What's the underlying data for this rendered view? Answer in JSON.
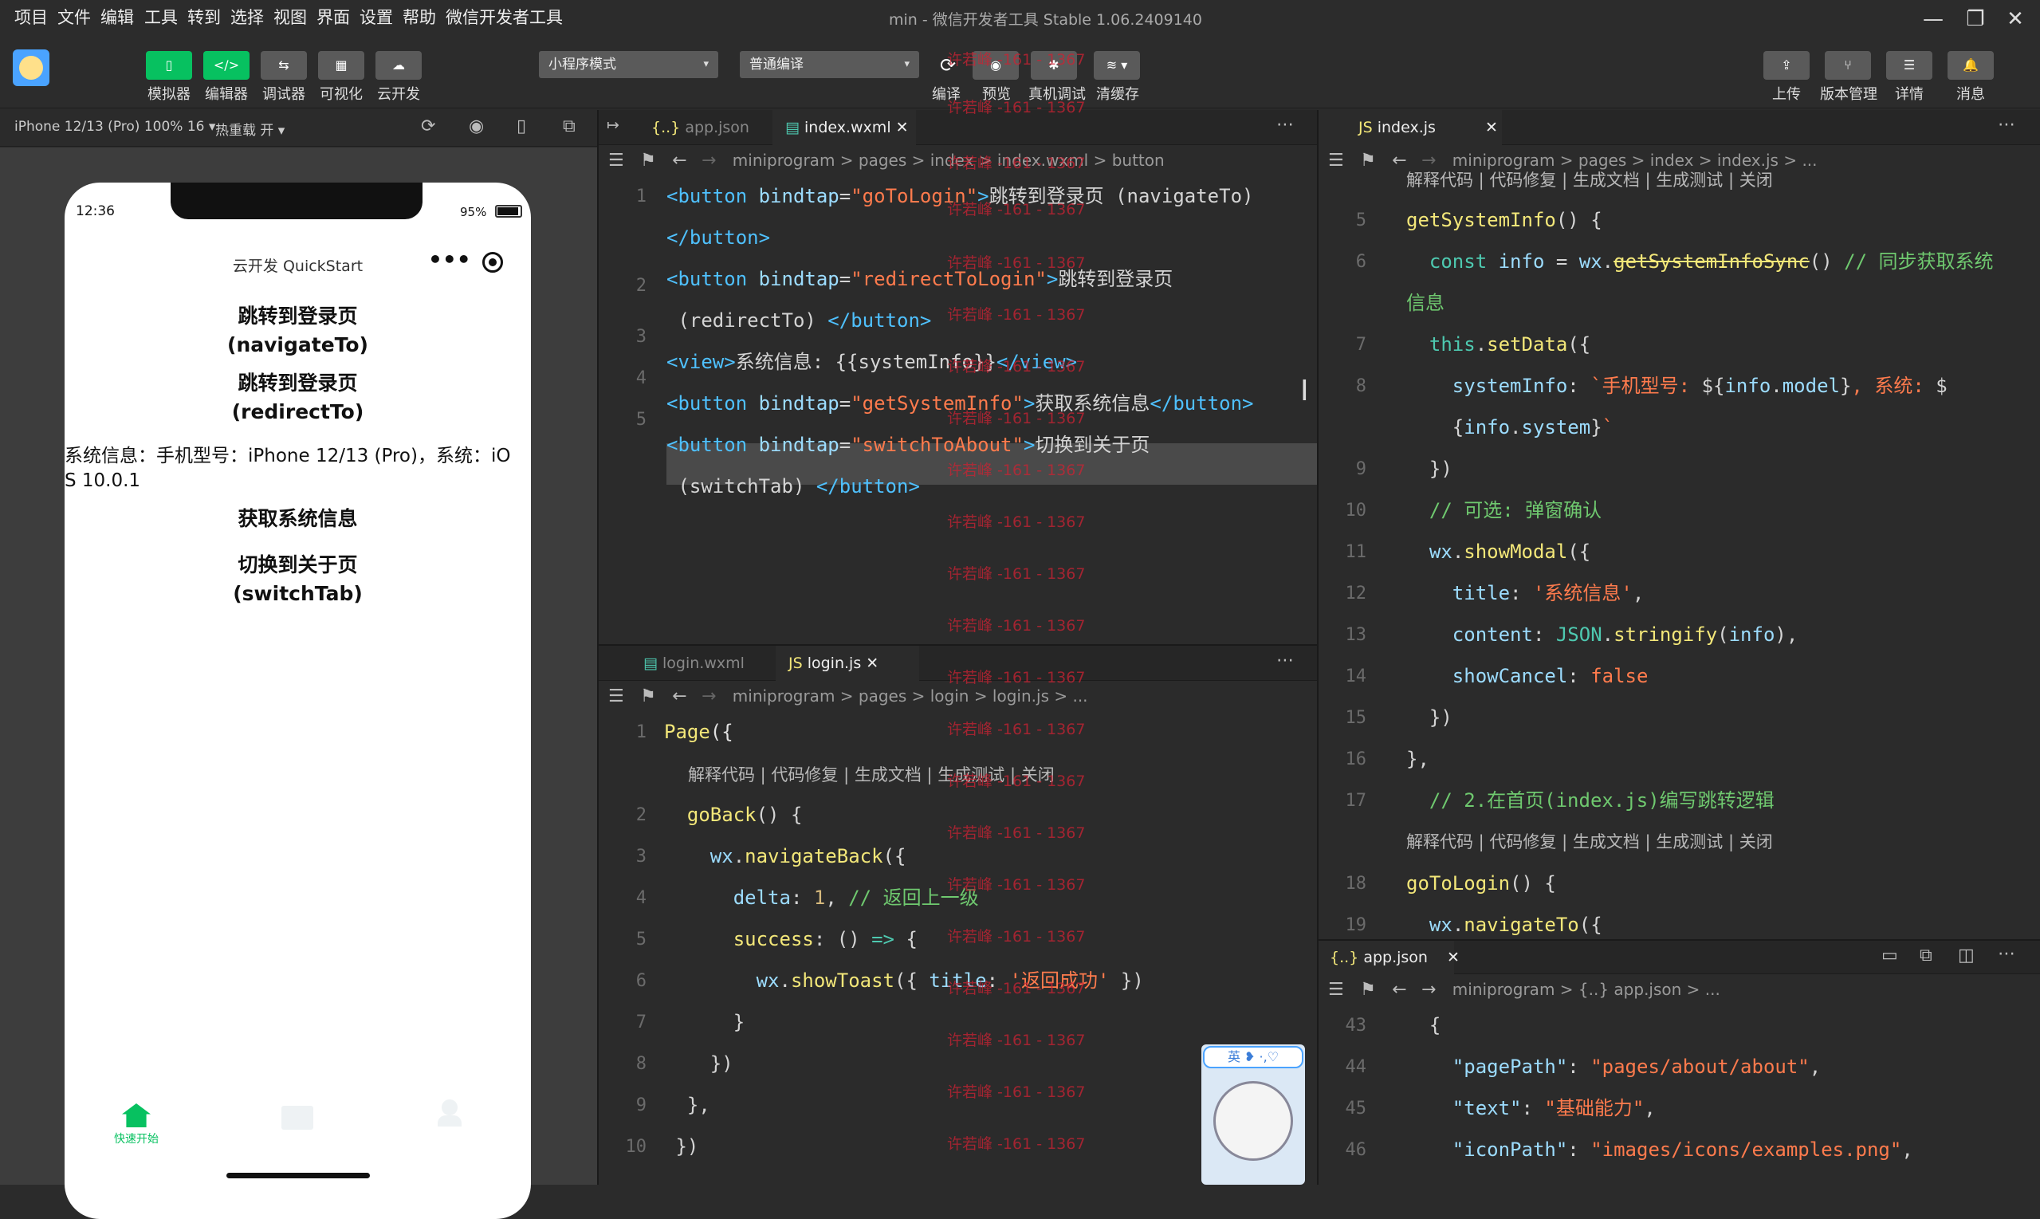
{
  "menu": [
    "项目",
    "文件",
    "编辑",
    "工具",
    "转到",
    "选择",
    "视图",
    "界面",
    "设置",
    "帮助",
    "微信开发者工具"
  ],
  "window_title": "min - 微信开发者工具 Stable 1.06.2409140",
  "toolbar": {
    "left": [
      "模拟器",
      "编辑器",
      "调试器",
      "可视化",
      "云开发"
    ],
    "mode_select": "小程序模式",
    "compile_select": "普通编译",
    "center": [
      "编译",
      "预览",
      "真机调试",
      "清缓存"
    ],
    "right": [
      "上传",
      "版本管理",
      "详情",
      "消息"
    ]
  },
  "simulator": {
    "device_label": "iPhone 12/13 (Pro) 100% 16 ▾",
    "hot_reload": "热重载 开 ▾",
    "time": "12:36",
    "battery": "95%",
    "nav_title": "云开发 QuickStart",
    "buttons": [
      {
        "l1": "跳转到登录页",
        "l2": "(navigateTo)"
      },
      {
        "l1": "跳转到登录页",
        "l2": "(redirectTo)"
      }
    ],
    "sysinfo": "系统信息：手机型号：iPhone 12/13 (Pro)，系统：iOS 10.0.1",
    "btn3": "获取系统信息",
    "btn4_l1": "切换到关于页",
    "btn4_l2": "(switchTab)",
    "tabbar": [
      "快速开始",
      "",
      ""
    ],
    "tab_active_color": "#07c160"
  },
  "editor1": {
    "tabs": [
      "app.json",
      "index.wxml"
    ],
    "breadcrumb": "miniprogram > pages > index > index.wxml > button",
    "line_numbers": [
      "1",
      "2",
      "3",
      "4",
      "5"
    ]
  },
  "editor2": {
    "tabs": [
      "login.wxml",
      "login.js"
    ],
    "breadcrumb": "miniprogram > pages > login > login.js > ...",
    "codelens": "解释代码 | 代码修复 | 生成文档 | 生成测试 | 关闭",
    "line_numbers": [
      "1",
      "2",
      "3",
      "4",
      "5",
      "6",
      "7",
      "8",
      "9",
      "10"
    ]
  },
  "editor3": {
    "tabs": [
      "index.js"
    ],
    "breadcrumb": "miniprogram > pages > index > index.js > ...",
    "codelens": "解释代码 | 代码修复 | 生成文档 | 生成测试 | 关闭",
    "line_numbers": [
      "5",
      "6",
      "",
      "7",
      "8",
      "",
      "9",
      "10",
      "11",
      "12",
      "13",
      "14",
      "15",
      "16",
      "17",
      "",
      "18",
      "19"
    ]
  },
  "editor4": {
    "tabs": [
      "app.json"
    ],
    "breadcrumb": "miniprogram > {..} app.json > ...",
    "line_numbers": [
      "43",
      "44",
      "45",
      "46"
    ]
  },
  "watermark": "许若峰 -161 - 1367",
  "sticker": "英 ❥ ·,♡",
  "accent": "#07c160"
}
